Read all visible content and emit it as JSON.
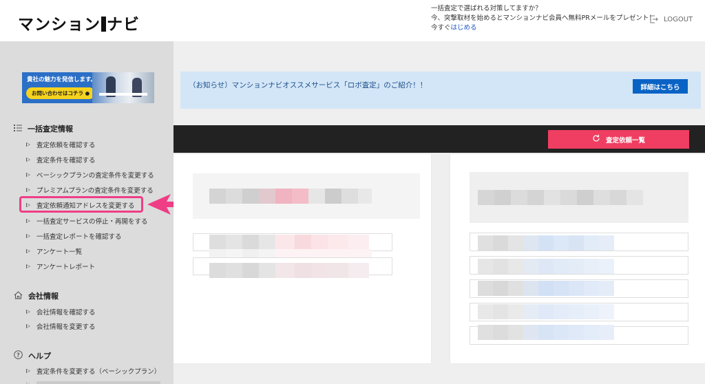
{
  "header": {
    "logo_left": "マンション",
    "logo_right": "ナビ",
    "notice_line1": "一括査定で選ばれる対策してますか？",
    "notice_line2": "今、突撃取材を始めるとマンションナビ会員へ無料PRメールをプレゼント！",
    "notice_line3_prefix": "今すぐ",
    "notice_link": "はじめる",
    "logout": "LOGOUT"
  },
  "sidebar": {
    "banner": {
      "text": "貴社の魅力を発信します。",
      "button": "お問い合わせはコチラ ●"
    },
    "sections": [
      {
        "title": "一括査定情報",
        "items": [
          "査定依頼を確認する",
          "査定条件を確認する",
          "ベーシックプランの査定条件を変更する",
          "プレミアムプランの査定条件を変更する",
          "査定依頼通知アドレスを変更する",
          "一括査定サービスの停止・再開をする",
          "一括査定レポートを確認する",
          "アンケート一覧",
          "アンケートレポート"
        ]
      },
      {
        "title": "会社情報",
        "items": [
          "会社情報を確認する",
          "会社情報を変更する"
        ]
      },
      {
        "title": "ヘルプ",
        "items": [
          "査定条件を変更する（ベーシックプラン）"
        ]
      }
    ]
  },
  "main": {
    "info_text": "（お知らせ）マンションナビオススメサービス「ロボ査定」のご紹介！！",
    "detail_button": "詳細はこちら",
    "list_button": "査定依頼一覧"
  },
  "colors": {
    "highlight": "#ef3d86",
    "list_button": "#ef3e61",
    "detail_button": "#0a63c4",
    "info_bg": "#d3e6f7"
  }
}
